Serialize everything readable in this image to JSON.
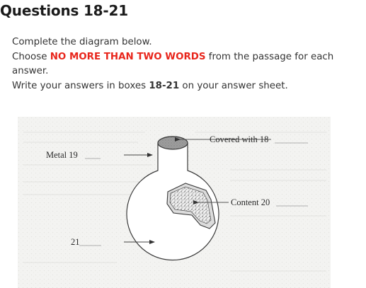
{
  "section": {
    "title": "Questions 18-21"
  },
  "instructions": {
    "line1": "Complete the diagram below.",
    "choose_prefix": "Choose ",
    "choose_emphasis": "NO MORE THAN TWO WORDS",
    "choose_suffix": " from the passage for each answer.",
    "write_prefix": "Write your answers in boxes ",
    "write_boxes": "18-21",
    "write_suffix": " on your answer sheet."
  },
  "diagram": {
    "labels": {
      "metal": "Metal 19",
      "covered": "Covered with 18",
      "content": "Content 20",
      "item21": "21"
    },
    "colors": {
      "emphasis": "#e8261c",
      "scan_background": "#f2f2f0",
      "cap_fill": "#9a9a9a"
    }
  }
}
